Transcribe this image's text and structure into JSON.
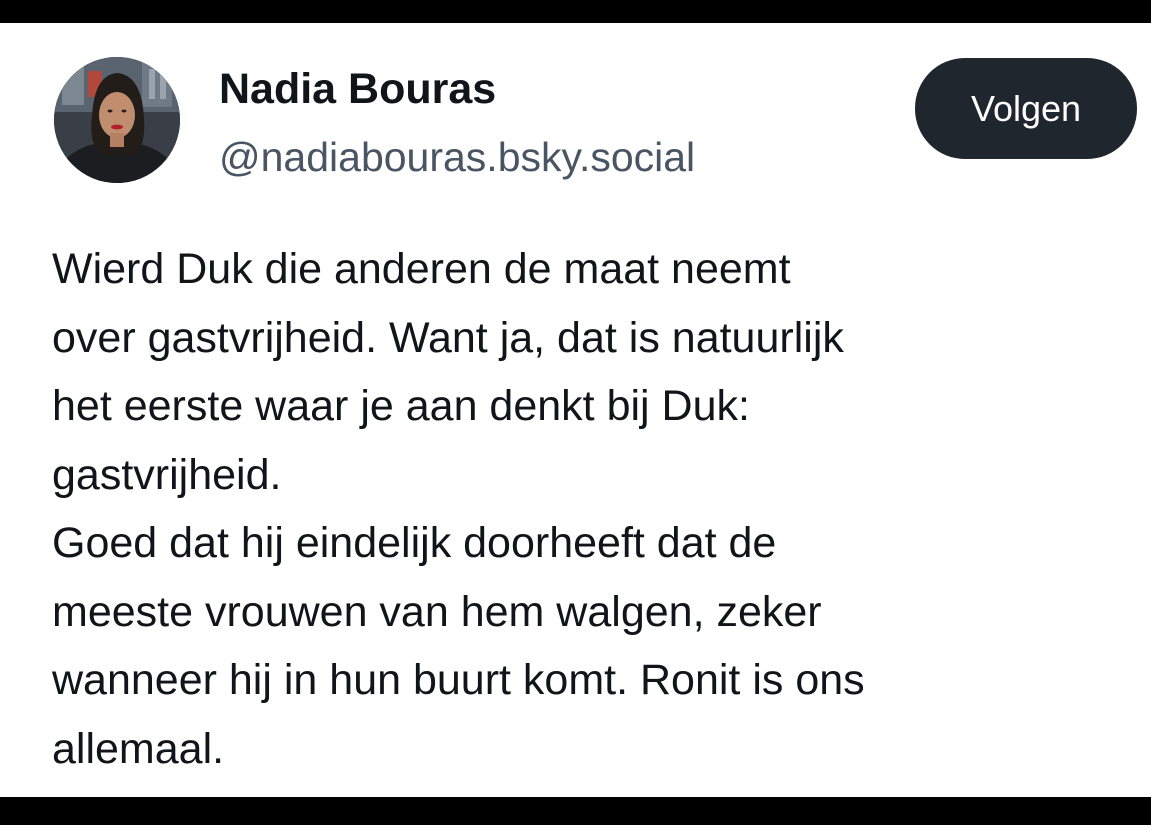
{
  "post": {
    "author": {
      "display_name": "Nadia Bouras",
      "handle": "@nadiabouras.bsky.social",
      "avatar_icon": "profile-photo"
    },
    "follow_button_label": "Volgen",
    "body_paragraphs": [
      "Wierd Duk die anderen de maat neemt\nover gastvrijheid. Want ja, dat is natuurlijk\nhet eerste waar je aan denkt bij Duk:\ngastvrijheid.",
      "Goed dat hij eindelijk doorheeft dat de\nmeeste vrouwen van hem walgen, zeker\nwanneer hij in hun buurt komt. Ronit is ons\nallemaal."
    ]
  },
  "colors": {
    "text_primary": "#111418",
    "text_secondary": "#4a5563",
    "button_bg": "#20262e",
    "button_text": "#ffffff",
    "card_bg": "#ffffff",
    "frame": "#000000"
  }
}
